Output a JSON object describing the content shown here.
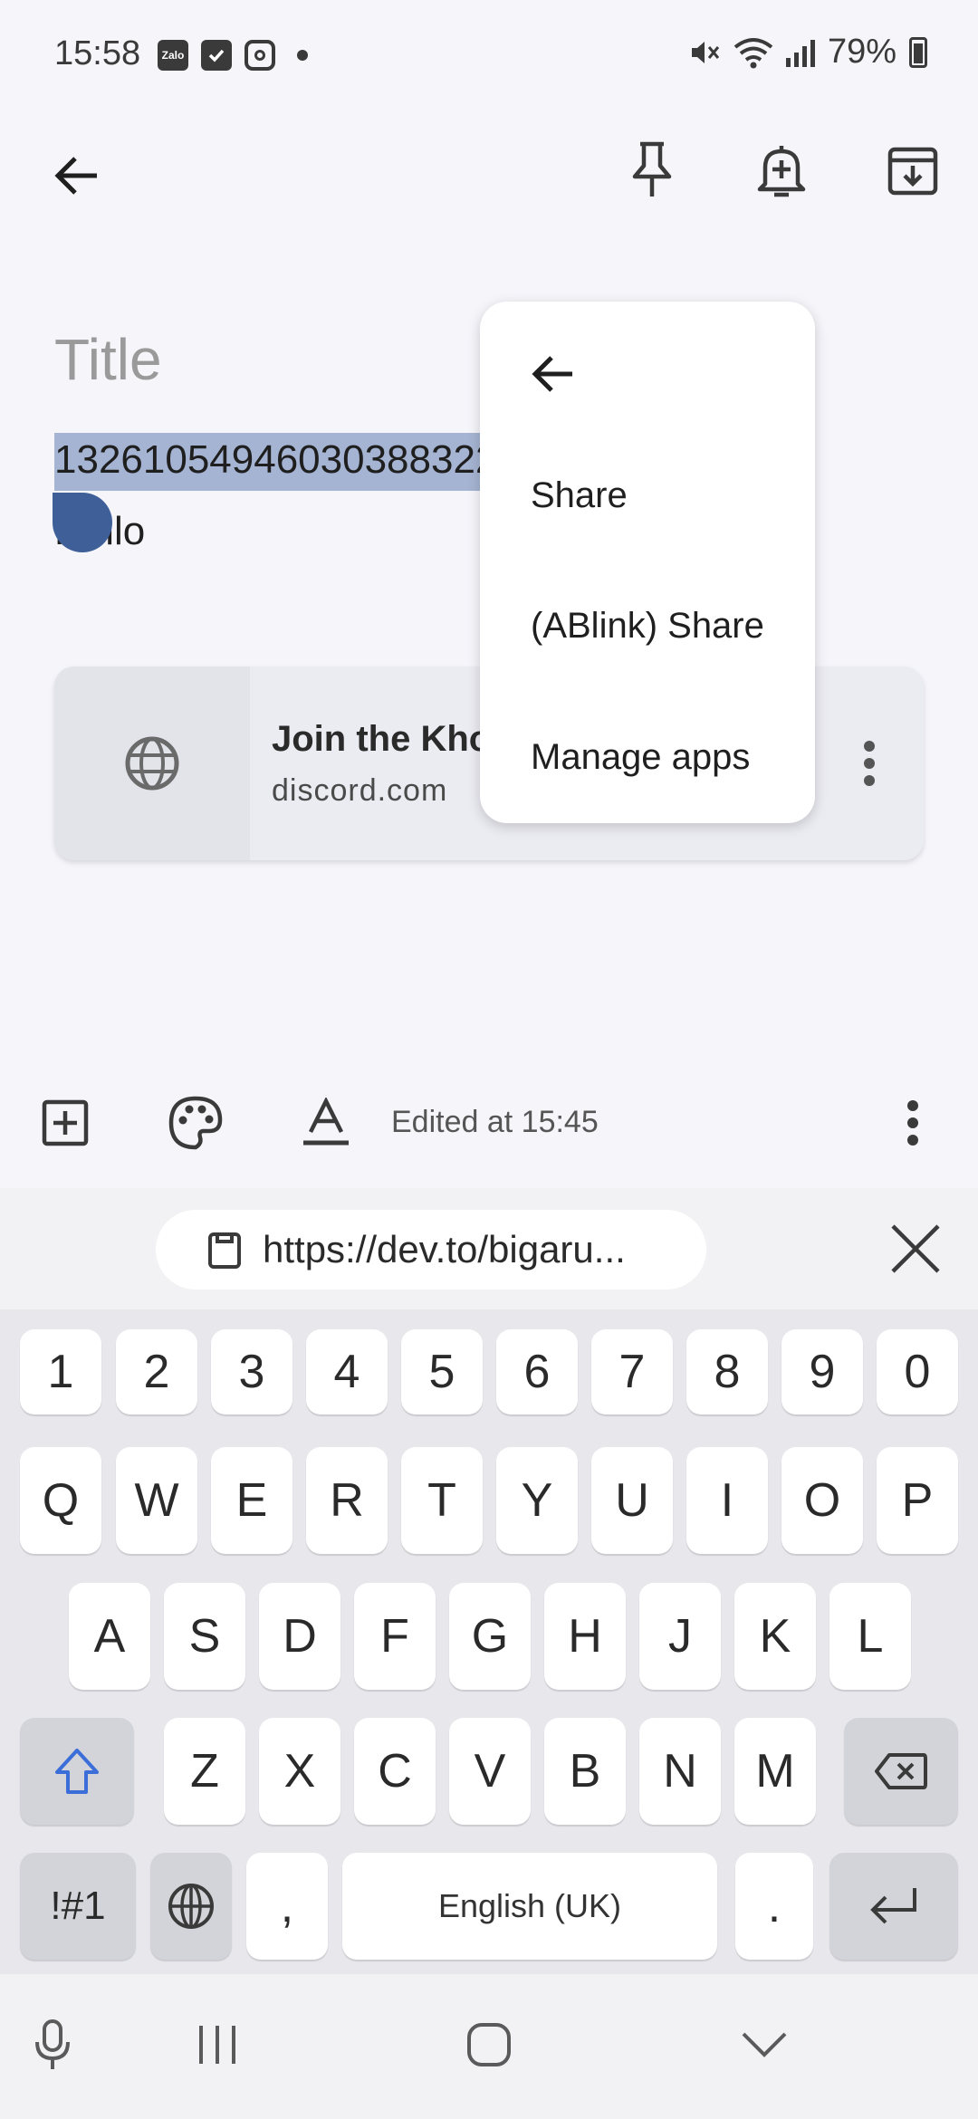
{
  "status_bar": {
    "time": "15:58",
    "left_icons": [
      "Zalo",
      "checkbox-icon",
      "instagram-icon",
      "dot-icon"
    ],
    "zalo_label": "Zalo",
    "battery": "79%",
    "right_icons": [
      "mute-icon",
      "wifi-icon",
      "signal-icon",
      "battery-icon"
    ]
  },
  "top_bar": {
    "actions": [
      "back-arrow-icon",
      "pin-icon",
      "reminder-icon",
      "archive-icon"
    ]
  },
  "note": {
    "title_placeholder": "Title",
    "body_line1": "13261054946030388322",
    "body_line2": "Hello",
    "selection_color": "#a5b4d2"
  },
  "link_card": {
    "title": "Join the Kho",
    "url": "discord.com",
    "icon": "globe-icon"
  },
  "popup_menu": {
    "items": [
      "Share",
      "(ABlink) Share",
      "Manage apps"
    ]
  },
  "editor_toolbar": {
    "edited_text": "Edited at 15:45",
    "icons": [
      "add-box-icon",
      "palette-icon",
      "text-format-icon",
      "more-vert-icon"
    ]
  },
  "clipboard": {
    "text": "https://dev.to/bigaru...",
    "icon": "clipboard-icon"
  },
  "keyboard": {
    "row_numbers": [
      "1",
      "2",
      "3",
      "4",
      "5",
      "6",
      "7",
      "8",
      "9",
      "0"
    ],
    "row1": [
      "Q",
      "W",
      "E",
      "R",
      "T",
      "Y",
      "U",
      "I",
      "O",
      "P"
    ],
    "row2": [
      "A",
      "S",
      "D",
      "F",
      "G",
      "H",
      "J",
      "K",
      "L"
    ],
    "row3": [
      "Z",
      "X",
      "C",
      "V",
      "B",
      "N",
      "M"
    ],
    "symbols_label": "!#1",
    "comma_label": ",",
    "space_label": "English (UK)",
    "period_label": ".",
    "shift_accent": "#3b6ed9"
  },
  "nav_bar": {
    "icons": [
      "mic-icon",
      "recents-icon",
      "home-icon",
      "back-chevron-icon"
    ]
  }
}
